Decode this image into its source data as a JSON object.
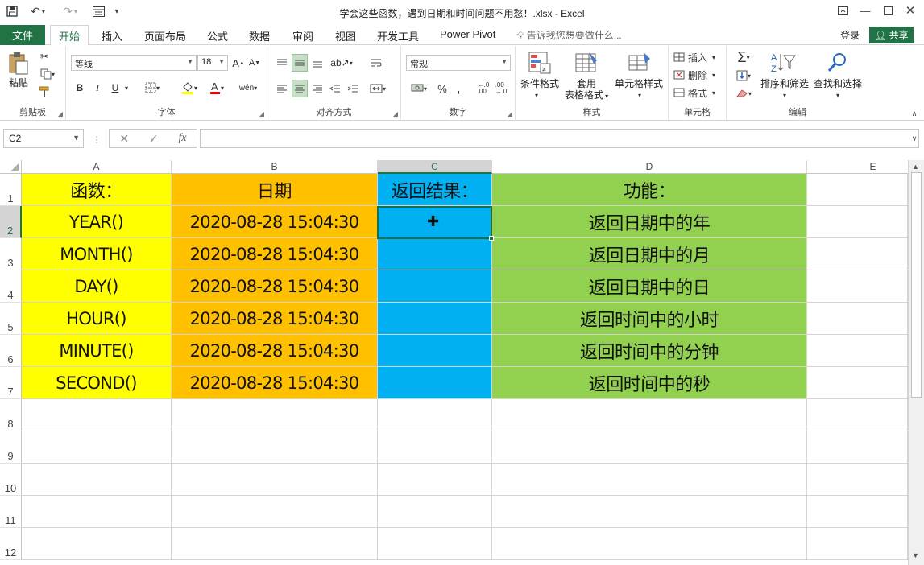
{
  "window": {
    "title": "学会这些函数，遇到日期和时间问题不用愁！.xlsx - Excel"
  },
  "tabs": {
    "file": "文件",
    "items": [
      "开始",
      "插入",
      "页面布局",
      "公式",
      "数据",
      "审阅",
      "视图",
      "开发工具",
      "Power Pivot"
    ],
    "tell_me": "告诉我您想要做什么...",
    "login": "登录",
    "share": "共享"
  },
  "ribbon": {
    "clipboard": {
      "paste": "粘贴",
      "label": "剪贴板"
    },
    "font": {
      "name": "等线",
      "size": "18",
      "label": "字体",
      "bold": "B",
      "italic": "I",
      "underline": "U",
      "grow": "A",
      "shrink": "A",
      "phonetic": "wén"
    },
    "alignment": {
      "label": "对齐方式"
    },
    "number": {
      "format": "常规",
      "label": "数字",
      "percent": "%",
      "comma": ","
    },
    "styles": {
      "conditional": "条件格式",
      "table_line1": "套用",
      "table_line2": "表格格式",
      "cell_styles": "单元格样式",
      "label": "样式"
    },
    "cells": {
      "insert": "插入",
      "delete": "删除",
      "format": "格式",
      "label": "单元格"
    },
    "editing": {
      "sort_filter": "排序和筛选",
      "find_select": "查找和选择",
      "label": "编辑"
    }
  },
  "formula_bar": {
    "name_box": "C2",
    "cancel": "✕",
    "confirm": "✓",
    "fx": "fx",
    "content": ""
  },
  "sheet": {
    "columns": [
      "A",
      "B",
      "C",
      "D",
      "E"
    ],
    "rows": [
      "1",
      "2",
      "3",
      "4",
      "5",
      "6",
      "7",
      "8",
      "9",
      "10",
      "11",
      "12"
    ],
    "header_row": [
      "函数：",
      "日期",
      "返回结果：",
      "功能："
    ],
    "data": [
      [
        "YEAR()",
        "2020-08-28 15:04:30",
        "",
        "返回日期中的年"
      ],
      [
        "MONTH()",
        "2020-08-28 15:04:30",
        "",
        "返回日期中的月"
      ],
      [
        "DAY()",
        "2020-08-28 15:04:30",
        "",
        "返回日期中的日"
      ],
      [
        "HOUR()",
        "2020-08-28 15:04:30",
        "",
        "返回时间中的小时"
      ],
      [
        "MINUTE()",
        "2020-08-28 15:04:30",
        "",
        "返回时间中的分钟"
      ],
      [
        "SECOND()",
        "2020-08-28 15:04:30",
        "",
        "返回时间中的秒"
      ]
    ],
    "selected_cell": "C2",
    "colors": {
      "col_a": "#ffff00",
      "col_b": "#ffc000",
      "col_c": "#00b0f0",
      "col_d": "#92d050",
      "accent": "#217346"
    }
  }
}
